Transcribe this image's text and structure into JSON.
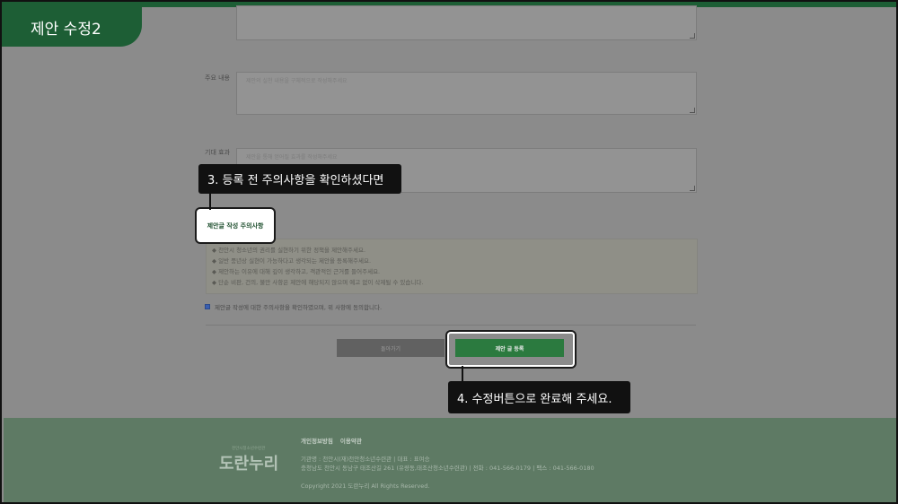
{
  "tutorial": {
    "badge_title": "제안 수정2",
    "step3": "3. 등록 전 주의사항을 확인하셨다면",
    "step4": "4. 수정버튼으로 완료해 주세요."
  },
  "form": {
    "field_main_label": "주요 내용",
    "field_main_placeholder": "제안의 실천 내용을 구체적으로 작성해주세요",
    "field_effect_label": "기대 효과",
    "field_effect_placeholder": "제안을 통해 얻어질 효과를 작성해주세요"
  },
  "notice": {
    "title": "제안글 작성 주의사항",
    "lines": [
      "◆ 천안시 청소년의 권리를 실현하기 위한 정책을 제안해주세요.",
      "◆ 일반 풍년상 실현이 가능하다고 생각되는 제안을 등록해주세요.",
      "◆ 제안하는 이유에 대해 깊이 생각하고, 객관적인 근거를 들어주세요.",
      "◆ 단순 비판, 건의, 불만 사항은 제안에 해당되지 않으며 예고 없이 삭제될 수 있습니다."
    ],
    "agree_text": "제안글 작성에 대한 주의사항을 확인하였으며, 위 사항에 동의합니다.",
    "agree_checked": true
  },
  "buttons": {
    "back": "돌아가기",
    "submit": "제안 글 등록"
  },
  "footer": {
    "logo_sub": "천안시청소년수련관",
    "logo_main": "도란누리",
    "links": [
      "개인정보방침",
      "이용약관"
    ],
    "info_line1": "기관명 : 천안시(재)천안청소년수련관 | 대표 : 표여승",
    "info_line2": "충청남도 천안시 동남구 태조산길 261 (유량동,태조산청소년수련관) | 전화 : 041-566-0179 | 팩스 : 041-566-0180",
    "copyright": "Copyright 2021 도란누리 All Rights Reserved."
  },
  "colors": {
    "brand_green": "#1d5e35",
    "submit_green": "#2b7a3f",
    "footer_green": "#5e7a64",
    "overlay_gray": "#8b8b8b"
  }
}
